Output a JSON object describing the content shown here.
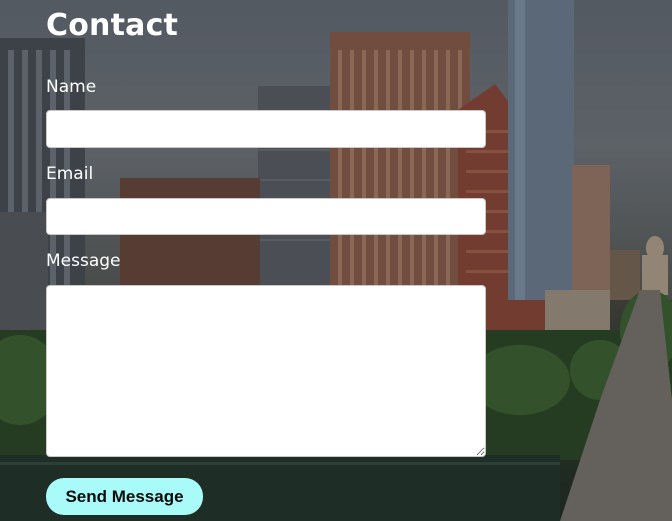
{
  "contact": {
    "title": "Contact",
    "name_label": "Name",
    "email_label": "Email",
    "message_label": "Message",
    "name_value": "",
    "email_value": "",
    "message_value": "",
    "submit_label": "Send Message"
  },
  "colors": {
    "button_bg": "#a8fbf8",
    "label_text": "#ffffff",
    "field_bg": "#ffffff"
  }
}
